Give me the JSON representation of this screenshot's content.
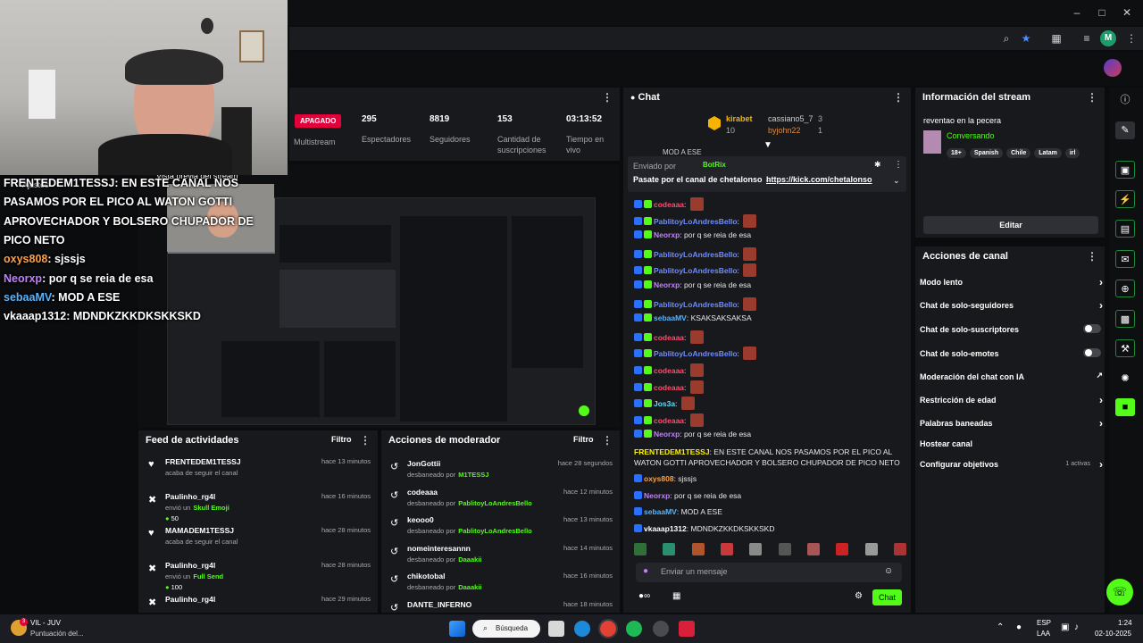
{
  "browser": {
    "addr_icons": [
      "zoom-icon",
      "star-icon",
      "extensions-icon",
      "media-icon",
      "profile-icon",
      "menu-icon"
    ],
    "profile_initial": "M"
  },
  "stream_stats": {
    "status_badge": "APAGADO",
    "multistream_label": "Multistream",
    "viewers": "295",
    "viewers_label": "Espectadores",
    "followers": "8819",
    "followers_label": "Seguidores",
    "subs": "153",
    "subs_label": "Cantidad de suscripciones",
    "uptime": "03:13:52",
    "uptime_label": "Tiempo en vivo",
    "preview_label": "Vista previa del stream",
    "settings_label": "Ajustes"
  },
  "chat": {
    "title": "Chat",
    "leaderboard": [
      {
        "name": "kirabet",
        "value": "10"
      },
      {
        "name": "cassiano5_7",
        "value": "3"
      },
      {
        "name": "byjohn22",
        "value": "1"
      }
    ],
    "partial_top": "MOD A ESE",
    "pinned_by_label": "Enviado por",
    "pinned_by": "BotRix",
    "pinned_text": "Pasate por el canal de chetalonso →",
    "pinned_link": "https://kick.com/chetalonso",
    "messages": [
      {
        "user": "codeaaa",
        "text": "",
        "color": "#ff4d6d",
        "emote": true
      },
      {
        "user": "PablitoyLoAndresBello",
        "text": "",
        "color": "#6f8cff",
        "emote": true
      },
      {
        "user": "Neorxp",
        "text": "por q se reia de esa",
        "color": "#c080ff",
        "emote": false
      },
      {
        "user": "PablitoyLoAndresBello",
        "text": "",
        "color": "#6f8cff",
        "emote": true
      },
      {
        "user": "PablitoyLoAndresBello",
        "text": "",
        "color": "#6f8cff",
        "emote": true
      },
      {
        "user": "Neorxp",
        "text": "por q se reia de esa",
        "color": "#c080ff",
        "emote": false
      },
      {
        "user": "PablitoyLoAndresBello",
        "text": "",
        "color": "#6f8cff",
        "emote": true
      },
      {
        "user": "sebaaMV",
        "text": "KSAKSAKSAKSA",
        "color": "#56b4ff",
        "emote": false
      },
      {
        "user": "codeaaa",
        "text": "",
        "color": "#ff4d6d",
        "emote": true
      },
      {
        "user": "PablitoyLoAndresBello",
        "text": "",
        "color": "#6f8cff",
        "emote": true
      },
      {
        "user": "codeaaa",
        "text": "",
        "color": "#ff4d6d",
        "emote": true
      },
      {
        "user": "codeaaa",
        "text": "",
        "color": "#ff4d6d",
        "emote": true
      },
      {
        "user": "Jos3a",
        "text": "",
        "color": "#56e0ff",
        "emote": true
      },
      {
        "user": "codeaaa",
        "text": "",
        "color": "#ff4d6d",
        "emote": true
      },
      {
        "user": "Neorxp",
        "text": "por q se reia de esa",
        "color": "#c080ff",
        "emote": false
      }
    ],
    "long_msg_user": "FRENTEDEM1TESSJ",
    "long_msg_text": "EN ESTE CANAL NOS PASAMOS POR EL PICO AL WATON GOTTI APROVECHADOR Y BOLSERO CHUPADOR DE PICO NETO",
    "tail": [
      {
        "user": "oxys808",
        "text": "sjssjs",
        "color": "#ff9f43"
      },
      {
        "user": "Neorxp",
        "text": "por q se reia de esa",
        "color": "#c080ff"
      },
      {
        "user": "sebaaMV",
        "text": "MOD A ESE",
        "color": "#56b4ff"
      },
      {
        "user": "vkaaap1312",
        "text": "MDNDKZKKDKSKKSKD",
        "color": "#ffffff"
      }
    ],
    "input_placeholder": "Enviar un mensaje",
    "send_label": "Chat"
  },
  "stream_info": {
    "title": "Información del stream",
    "stream_title": "reventao en la pecera",
    "category": "Conversando",
    "tags": [
      "18+",
      "Spanish",
      "Chile",
      "Latam",
      "irl"
    ],
    "edit_label": "Editar"
  },
  "channel_actions": {
    "title": "Acciones de canal",
    "items": [
      {
        "label": "Modo lento",
        "kind": "chevron"
      },
      {
        "label": "Chat de solo-seguidores",
        "kind": "chevron"
      },
      {
        "label": "Chat de solo-suscriptores",
        "kind": "toggle"
      },
      {
        "label": "Chat de solo-emotes",
        "kind": "toggle"
      },
      {
        "label": "Moderación del chat con IA",
        "kind": "external"
      },
      {
        "label": "Restricción de edad",
        "kind": "chevron"
      },
      {
        "label": "Palabras baneadas",
        "kind": "chevron"
      },
      {
        "label": "Hostear canal",
        "kind": "none"
      },
      {
        "label": "Configurar objetivos",
        "kind": "chevron",
        "extra": "1 activas"
      }
    ]
  },
  "activity_feed": {
    "title": "Feed de actividades",
    "filter_label": "Filtro",
    "items": [
      {
        "icon": "heart-icon",
        "name": "FRENTEDEM1TESSJ",
        "time": "hace 13 minutos",
        "sub": "acaba de seguir el canal",
        "extra": "",
        "amount": ""
      },
      {
        "icon": "gift-icon",
        "name": "Paulinho_rg4l",
        "time": "hace 16 minutos",
        "sub": "envió un",
        "extra": "Skull Emoji",
        "amount": "50"
      },
      {
        "icon": "heart-icon",
        "name": "MAMADEM1TESSJ",
        "time": "hace 28 minutos",
        "sub": "acaba de seguir el canal",
        "extra": "",
        "amount": ""
      },
      {
        "icon": "gift-icon",
        "name": "Paulinho_rg4l",
        "time": "hace 28 minutos",
        "sub": "envió un",
        "extra": "Full Send",
        "amount": "100"
      },
      {
        "icon": "gift-icon",
        "name": "Paulinho_rg4l",
        "time": "hace 29 minutos",
        "sub": "",
        "extra": "",
        "amount": ""
      }
    ]
  },
  "mod_actions": {
    "title": "Acciones de moderador",
    "filter_label": "Filtro",
    "items": [
      {
        "name": "JonGottii",
        "time": "hace 28 segundos",
        "action": "desbaneado por",
        "by": "M1TESSJ"
      },
      {
        "name": "codeaaa",
        "time": "hace 12 minutos",
        "action": "desbaneado por",
        "by": "PablitoyLoAndresBello"
      },
      {
        "name": "keooo0",
        "time": "hace 13 minutos",
        "action": "desbaneado por",
        "by": "PablitoyLoAndresBello"
      },
      {
        "name": "nomeinteresannn",
        "time": "hace 14 minutos",
        "action": "desbaneado por",
        "by": "Daaakii"
      },
      {
        "name": "chikotobal",
        "time": "hace 16 minutos",
        "action": "desbaneado por",
        "by": "Daaakii"
      },
      {
        "name": "DANTE_INFERNO",
        "time": "hace 18 minutos",
        "action": "",
        "by": ""
      }
    ]
  },
  "overlay_chat": {
    "lines": [
      {
        "user": "FRENTEDEM1TESSJ",
        "text": ": EN ESTE CANAL NOS",
        "color": "#ffffff"
      },
      {
        "user": "",
        "text": "PASAMOS POR EL PICO AL WATON GOTTI",
        "color": "#ffffff"
      },
      {
        "user": "",
        "text": "APROVECHADOR Y BOLSERO CHUPADOR DE",
        "color": "#ffffff"
      },
      {
        "user": "",
        "text": "PICO NETO",
        "color": "#ffffff"
      },
      {
        "user": "oxys808",
        "text": ": sjssjs",
        "color": "#ff9f43"
      },
      {
        "user": "Neorxp",
        "text": ": por q se reia de esa",
        "color": "#c080ff"
      },
      {
        "user": "sebaaMV",
        "text": ": MOD A ESE",
        "color": "#56b4ff"
      },
      {
        "user": "vkaaap1312",
        "text": ": MDNDKZKKDKSKKSKD",
        "color": "#ffffff"
      }
    ]
  },
  "taskbar": {
    "weather_title": "VIL - JUV",
    "weather_sub": "Puntuación del...",
    "search_label": "Búsqueda",
    "lang1": "ESP",
    "lang2": "LAA",
    "time": "1:24",
    "date": "02-10-2025",
    "notif_count": "3"
  },
  "colors": {
    "accent": "#53fc18",
    "panel": "#18191c",
    "status_red": "#e4003a"
  }
}
